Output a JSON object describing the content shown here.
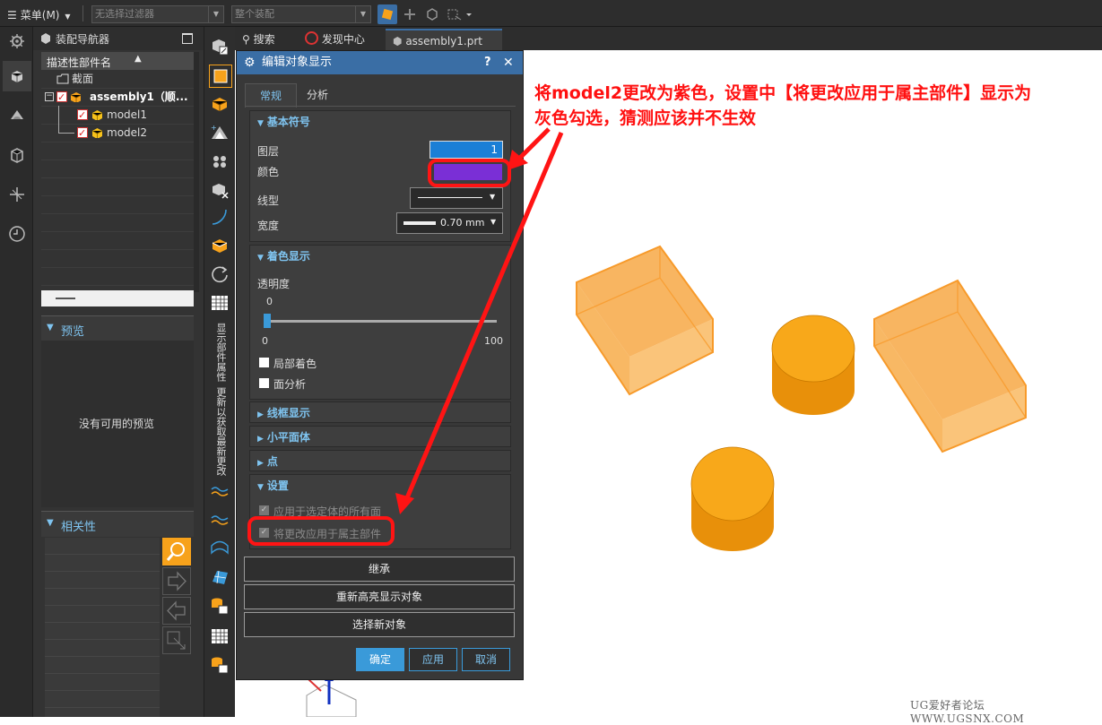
{
  "topbar": {
    "menu_label": "菜单(M)",
    "filter_placeholder": "无选择过滤器",
    "scope_value": "整个装配"
  },
  "navigator": {
    "title": "装配导航器",
    "column_header": "描述性部件名",
    "tree": [
      {
        "label": "截面"
      },
      {
        "label": "assembly1（顺..."
      },
      {
        "label": "model1"
      },
      {
        "label": "model2"
      }
    ],
    "preview_title": "预览",
    "preview_empty": "没有可用的预览",
    "dependency_title": "相关性"
  },
  "tabs": [
    {
      "label": "搜索"
    },
    {
      "label": "发现中心"
    },
    {
      "label": "assembly1.prt"
    }
  ],
  "vertical_labels": {
    "show_attr": "显示部件属性",
    "update_notice": "更新以获取最新更改"
  },
  "dialog": {
    "title": "编辑对象显示",
    "help": "?",
    "close": "✕",
    "tabs": [
      "常规",
      "分析"
    ],
    "basic_symbols": {
      "title": "基本符号",
      "layer_label": "图层",
      "layer_value": "1",
      "color_label": "颜色",
      "color_value": "#7a2fd6",
      "linetype_label": "线型",
      "width_label": "宽度",
      "width_value": "0.70 mm"
    },
    "shading": {
      "title": "着色显示",
      "transparency_label": "透明度",
      "transparency_value": "0",
      "slider_min": "0",
      "slider_max": "100",
      "partial_shading": "局部着色",
      "face_analysis": "面分析"
    },
    "wireframe_title": "线框显示",
    "facet_title": "小平面体",
    "point_title": "点",
    "settings": {
      "title": "设置",
      "apply_all_faces": "应用于选定体的所有面",
      "apply_to_owner": "将更改应用于属主部件"
    },
    "buttons": {
      "inherit": "继承",
      "rehighlight": "重新高亮显示对象",
      "select_new": "选择新对象",
      "ok": "确定",
      "apply": "应用",
      "cancel": "取消"
    }
  },
  "annotation": {
    "line1": "将model2更改为紫色，设置中【将更改应用于属主部件】显示为",
    "line2": "灰色勾选，猜测应该并不生效"
  },
  "watermark": "UG爱好者论坛 WWW.UGSNX.COM",
  "colors": {
    "accent": "#3a6ea5",
    "highlight_blue": "#1b7fd6",
    "model_orange": "#f7a21b",
    "annotation_red": "#ff1414"
  }
}
